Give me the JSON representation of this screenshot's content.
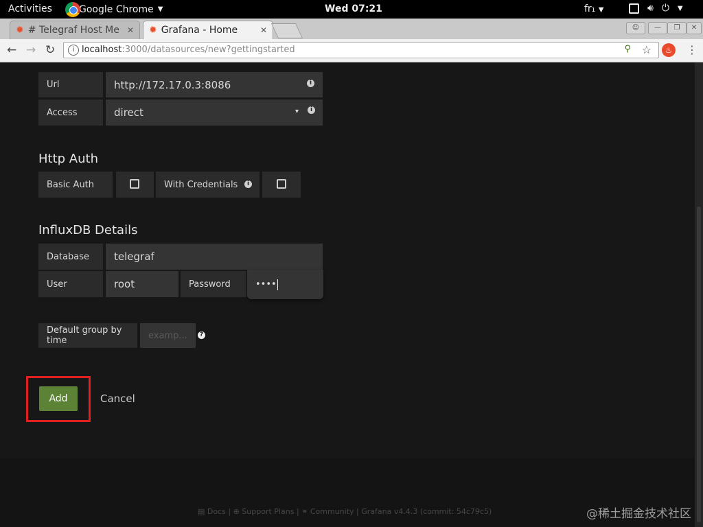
{
  "system_bar": {
    "activities": "Activities",
    "app_name": "Google Chrome",
    "clock": "Wed 07:21",
    "keyboard": "fr₁"
  },
  "browser": {
    "tabs": [
      {
        "label": "# Telegraf Host Me",
        "active": false
      },
      {
        "label": "Grafana - Home",
        "active": true
      }
    ],
    "url_host": "localhost",
    "url_rest": ":3000/datasources/new?gettingstarted"
  },
  "http": {
    "url_label": "Url",
    "url_value": "http://172.17.0.3:8086",
    "access_label": "Access",
    "access_value": "direct"
  },
  "http_auth": {
    "title": "Http Auth",
    "basic_auth_label": "Basic Auth",
    "with_credentials_label": "With Credentials"
  },
  "influx": {
    "title": "InfluxDB Details",
    "database_label": "Database",
    "database_value": "telegraf",
    "user_label": "User",
    "user_value": "root",
    "password_label": "Password",
    "password_value": "••••",
    "group_label": "Default group by time",
    "group_placeholder": "examp..."
  },
  "actions": {
    "add_label": "Add",
    "cancel_label": "Cancel"
  },
  "footer": {
    "docs": "Docs",
    "support": "Support Plans",
    "community": "Community",
    "version": "Grafana v4.4.3 (commit: 54c79c5)"
  },
  "watermark": "@稀土掘金技术社区",
  "colors": {
    "add_button": "#5b8235",
    "highlight": "#e21f1f"
  }
}
